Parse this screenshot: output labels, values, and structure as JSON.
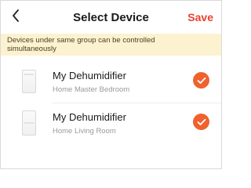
{
  "header": {
    "title": "Select Device",
    "save_label": "Save"
  },
  "notice": {
    "line1": "Devices under same group can be controlled",
    "line2": "simultaneously"
  },
  "devices": [
    {
      "name": "My Dehumidifier",
      "location": "Home  Master Bedroom",
      "selected": true
    },
    {
      "name": "My Dehumidifier",
      "location": "Home  Living Room",
      "selected": true
    }
  ],
  "colors": {
    "accent": "#f0622d",
    "save": "#e8432e",
    "notice_bg": "#fdf2cf"
  },
  "icons": {
    "back": "chevron-left-icon",
    "check": "checkmark-icon",
    "device": "dehumidifier-icon"
  }
}
